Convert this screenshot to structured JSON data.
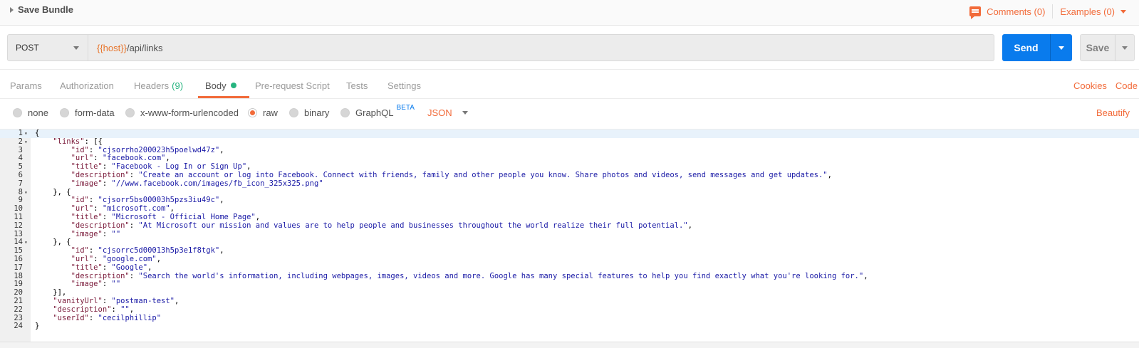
{
  "header": {
    "bundle_title": "Save Bundle",
    "comments_label": "Comments (0)",
    "examples_label": "Examples (0)"
  },
  "request": {
    "method": "POST",
    "url_var": "{{host}}",
    "url_path": "/api/links",
    "send_label": "Send",
    "save_label": "Save"
  },
  "tabs": {
    "items": [
      {
        "label": "Params"
      },
      {
        "label": "Authorization"
      },
      {
        "label": "Headers",
        "count": "(9)"
      },
      {
        "label": "Body"
      },
      {
        "label": "Pre-request Script"
      },
      {
        "label": "Tests"
      },
      {
        "label": "Settings"
      }
    ],
    "cookies": "Cookies",
    "code": "Code"
  },
  "body_types": {
    "options": [
      "none",
      "form-data",
      "x-www-form-urlencoded",
      "raw",
      "binary",
      "GraphQL"
    ],
    "selected": "raw",
    "beta": "BETA",
    "language": "JSON",
    "beautify": "Beautify"
  },
  "editor": {
    "lines": [
      {
        "n": "1",
        "fold": true,
        "hl": true,
        "t": [
          [
            "p",
            "{"
          ]
        ]
      },
      {
        "n": "2",
        "fold": true,
        "t": [
          [
            "p",
            "    "
          ],
          [
            "k",
            "\"links\""
          ],
          [
            "p",
            ": [{"
          ]
        ]
      },
      {
        "n": "3",
        "t": [
          [
            "p",
            "        "
          ],
          [
            "k",
            "\"id\""
          ],
          [
            "p",
            ": "
          ],
          [
            "s",
            "\"cjsorrho200023h5poelwd47z\""
          ],
          [
            "p",
            ","
          ]
        ]
      },
      {
        "n": "4",
        "t": [
          [
            "p",
            "        "
          ],
          [
            "k",
            "\"url\""
          ],
          [
            "p",
            ": "
          ],
          [
            "s",
            "\"facebook.com\""
          ],
          [
            "p",
            ","
          ]
        ]
      },
      {
        "n": "5",
        "t": [
          [
            "p",
            "        "
          ],
          [
            "k",
            "\"title\""
          ],
          [
            "p",
            ": "
          ],
          [
            "s",
            "\"Facebook - Log In or Sign Up\""
          ],
          [
            "p",
            ","
          ]
        ]
      },
      {
        "n": "6",
        "t": [
          [
            "p",
            "        "
          ],
          [
            "k",
            "\"description\""
          ],
          [
            "p",
            ": "
          ],
          [
            "s",
            "\"Create an account or log into Facebook. Connect with friends, family and other people you know. Share photos and videos, send messages and get updates.\""
          ],
          [
            "p",
            ","
          ]
        ]
      },
      {
        "n": "7",
        "t": [
          [
            "p",
            "        "
          ],
          [
            "k",
            "\"image\""
          ],
          [
            "p",
            ": "
          ],
          [
            "s",
            "\"//www.facebook.com/images/fb_icon_325x325.png\""
          ]
        ]
      },
      {
        "n": "8",
        "fold": true,
        "t": [
          [
            "p",
            "    }, {"
          ]
        ]
      },
      {
        "n": "9",
        "t": [
          [
            "p",
            "        "
          ],
          [
            "k",
            "\"id\""
          ],
          [
            "p",
            ": "
          ],
          [
            "s",
            "\"cjsorr5bs00003h5pzs3iu49c\""
          ],
          [
            "p",
            ","
          ]
        ]
      },
      {
        "n": "10",
        "t": [
          [
            "p",
            "        "
          ],
          [
            "k",
            "\"url\""
          ],
          [
            "p",
            ": "
          ],
          [
            "s",
            "\"microsoft.com\""
          ],
          [
            "p",
            ","
          ]
        ]
      },
      {
        "n": "11",
        "t": [
          [
            "p",
            "        "
          ],
          [
            "k",
            "\"title\""
          ],
          [
            "p",
            ": "
          ],
          [
            "s",
            "\"Microsoft - Official Home Page\""
          ],
          [
            "p",
            ","
          ]
        ]
      },
      {
        "n": "12",
        "t": [
          [
            "p",
            "        "
          ],
          [
            "k",
            "\"description\""
          ],
          [
            "p",
            ": "
          ],
          [
            "s",
            "\"At Microsoft our mission and values are to help people and businesses throughout the world realize their full potential.\""
          ],
          [
            "p",
            ","
          ]
        ]
      },
      {
        "n": "13",
        "t": [
          [
            "p",
            "        "
          ],
          [
            "k",
            "\"image\""
          ],
          [
            "p",
            ": "
          ],
          [
            "s",
            "\"\""
          ]
        ]
      },
      {
        "n": "14",
        "fold": true,
        "t": [
          [
            "p",
            "    }, {"
          ]
        ]
      },
      {
        "n": "15",
        "t": [
          [
            "p",
            "        "
          ],
          [
            "k",
            "\"id\""
          ],
          [
            "p",
            ": "
          ],
          [
            "s",
            "\"cjsorrc5d00013h5p3e1f8tgk\""
          ],
          [
            "p",
            ","
          ]
        ]
      },
      {
        "n": "16",
        "t": [
          [
            "p",
            "        "
          ],
          [
            "k",
            "\"url\""
          ],
          [
            "p",
            ": "
          ],
          [
            "s",
            "\"google.com\""
          ],
          [
            "p",
            ","
          ]
        ]
      },
      {
        "n": "17",
        "t": [
          [
            "p",
            "        "
          ],
          [
            "k",
            "\"title\""
          ],
          [
            "p",
            ": "
          ],
          [
            "s",
            "\"Google\""
          ],
          [
            "p",
            ","
          ]
        ]
      },
      {
        "n": "18",
        "t": [
          [
            "p",
            "        "
          ],
          [
            "k",
            "\"description\""
          ],
          [
            "p",
            ": "
          ],
          [
            "s",
            "\"Search the world's information, including webpages, images, videos and more. Google has many special features to help you find exactly what you're looking for.\""
          ],
          [
            "p",
            ","
          ]
        ]
      },
      {
        "n": "19",
        "t": [
          [
            "p",
            "        "
          ],
          [
            "k",
            "\"image\""
          ],
          [
            "p",
            ": "
          ],
          [
            "s",
            "\"\""
          ]
        ]
      },
      {
        "n": "20",
        "t": [
          [
            "p",
            "    }],"
          ]
        ]
      },
      {
        "n": "21",
        "t": [
          [
            "p",
            "    "
          ],
          [
            "k",
            "\"vanityUrl\""
          ],
          [
            "p",
            ": "
          ],
          [
            "s",
            "\"postman-test\""
          ],
          [
            "p",
            ","
          ]
        ]
      },
      {
        "n": "22",
        "t": [
          [
            "p",
            "    "
          ],
          [
            "k",
            "\"description\""
          ],
          [
            "p",
            ": "
          ],
          [
            "s",
            "\"\""
          ],
          [
            "p",
            ","
          ]
        ]
      },
      {
        "n": "23",
        "t": [
          [
            "p",
            "    "
          ],
          [
            "k",
            "\"userId\""
          ],
          [
            "p",
            ": "
          ],
          [
            "s",
            "\"cecilphillip\""
          ]
        ]
      },
      {
        "n": "24",
        "t": [
          [
            "p",
            "}"
          ]
        ]
      }
    ]
  }
}
